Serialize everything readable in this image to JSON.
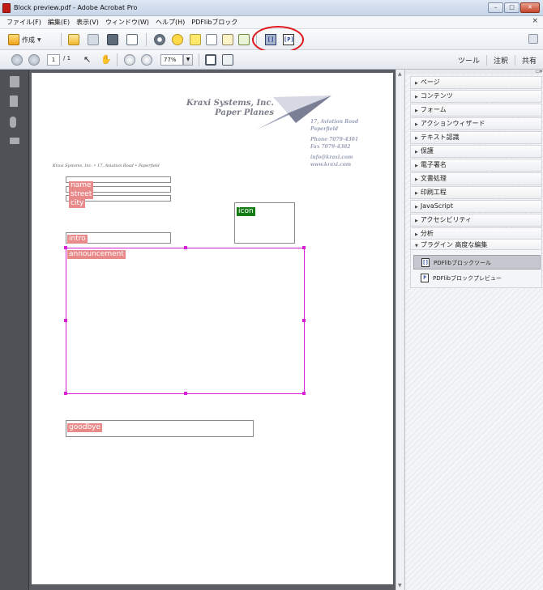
{
  "window": {
    "title": "Block preview.pdf - Adobe Acrobat Pro",
    "buttons": {
      "minimize": "–",
      "maximize": "□",
      "close": "✕"
    }
  },
  "menu": {
    "items": [
      "ファイル(F)",
      "編集(E)",
      "表示(V)",
      "ウィンドウ(W)",
      "ヘルプ(H)",
      "PDFlibブロック"
    ],
    "close_glyph": "×"
  },
  "toolbar": {
    "create_label": "作成",
    "plugin_icon_1": "[]",
    "plugin_icon_2": "[P]"
  },
  "navigation": {
    "page_current": "1",
    "page_total": "/ 1",
    "zoom": "77%"
  },
  "panel_links": [
    "ツール",
    "注釈",
    "共有"
  ],
  "document": {
    "company_line1": "Kraxi Systems, Inc.",
    "company_line2": "Paper Planes",
    "address": [
      "17, Aviation Road",
      "Paperfield"
    ],
    "contact": [
      "Phone 7079-4301",
      "Fax 7079-4302",
      "info@kraxi.com",
      "www.kraxi.com"
    ],
    "sender_line": "Kraxi Systems, Inc. • 17, Aviation Road • Paperfield",
    "blocks": {
      "name": "name",
      "street": "street",
      "city": "city",
      "icon": "icon",
      "intro": "intro",
      "announcement": "announcement",
      "goodbye": "goodbye"
    }
  },
  "right_panel": {
    "sections": [
      "ページ",
      "コンテンツ",
      "フォーム",
      "アクションウィザード",
      "テキスト認識",
      "保護",
      "電子署名",
      "文書処理",
      "印刷工程",
      "JavaScript",
      "アクセシビリティ",
      "分析",
      "プラグイン 高度な編集"
    ],
    "plugin_items": [
      "PDFlibブロックツール",
      "PDFlibブロックプレビュー"
    ]
  }
}
